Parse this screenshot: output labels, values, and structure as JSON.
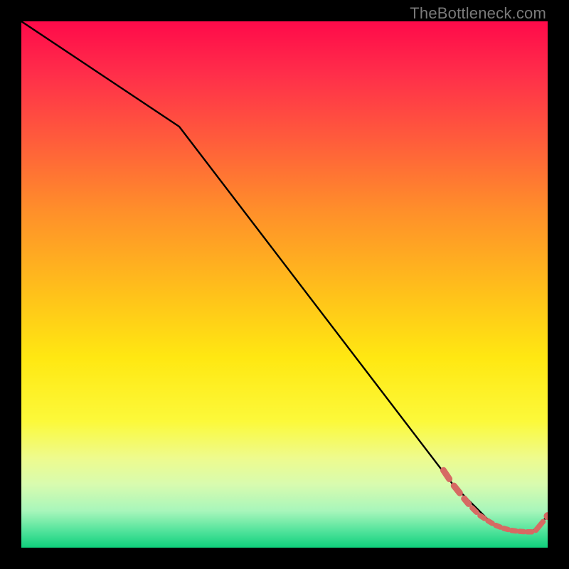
{
  "attribution": "TheBottleneck.com",
  "chart_data": {
    "type": "line",
    "title": "",
    "xlabel": "",
    "ylabel": "",
    "xlim": [
      0,
      100
    ],
    "ylim": [
      0,
      100
    ],
    "grid": false,
    "legend": false,
    "series": [
      {
        "name": "main-curve",
        "style": "solid",
        "color": "#000000",
        "x": [
          0,
          30,
          82,
          90,
          94,
          97,
          100
        ],
        "y": [
          100,
          80,
          12,
          4,
          3,
          3,
          6
        ]
      },
      {
        "name": "highlight-dashes",
        "style": "dashed-points",
        "color": "#d66a63",
        "x": [
          80,
          82,
          84,
          85.5,
          87,
          88.5,
          90,
          91.5,
          93,
          94.5,
          96,
          97.5,
          100
        ],
        "y": [
          15,
          12,
          9.5,
          7.7,
          6.2,
          5.2,
          4.3,
          3.7,
          3.3,
          3.1,
          3.0,
          3.0,
          6.0
        ]
      }
    ]
  }
}
